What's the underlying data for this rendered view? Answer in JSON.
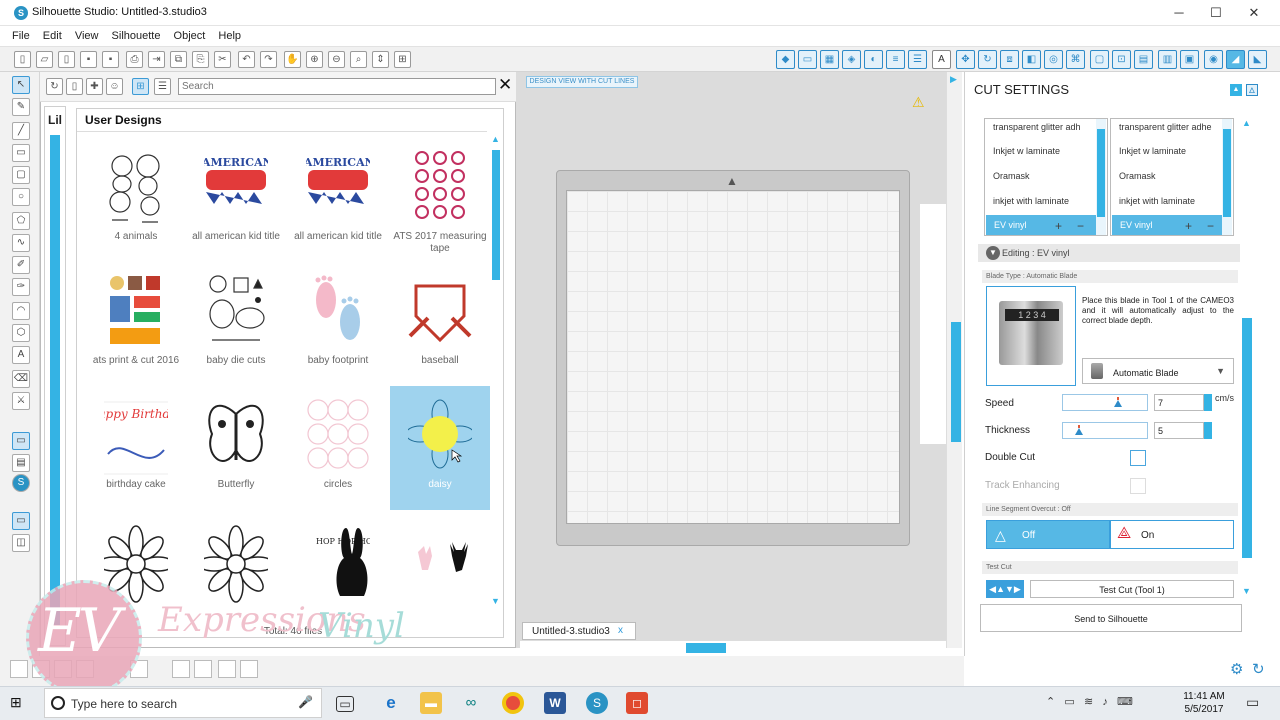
{
  "window": {
    "title": "Silhouette Studio: Untitled-3.studio3",
    "minimize": "─",
    "maximize": "☐",
    "close": "✕"
  },
  "menu": [
    "File",
    "Edit",
    "View",
    "Silhouette",
    "Object",
    "Help"
  ],
  "library": {
    "search_placeholder": "Search",
    "tab_label": "Lil",
    "close_label": "✕",
    "section_title": "User Designs",
    "total": "Total: 46 files",
    "designs": [
      {
        "label": "4 animals"
      },
      {
        "label": "all american kid title"
      },
      {
        "label": "all american kid title"
      },
      {
        "label": "ATS 2017 measuring tape"
      },
      {
        "label": "ats print & cut 2016"
      },
      {
        "label": "baby die cuts"
      },
      {
        "label": "baby footprint"
      },
      {
        "label": "baseball"
      },
      {
        "label": "birthday cake"
      },
      {
        "label": "Butterfly"
      },
      {
        "label": "circles"
      },
      {
        "label": "daisy"
      }
    ],
    "thumb_text": {
      "all_american": "ALL AMERICAN Kid",
      "happy_birthday": "Happy Birthday",
      "hop": "HOP HOP HOP"
    }
  },
  "canvas": {
    "design_view_label": "DESIGN VIEW WITH CUT LINES",
    "doc_tab": "Untitled-3.studio3",
    "doc_tab_close": "x"
  },
  "cut_settings": {
    "title": "CUT SETTINGS",
    "list_left": [
      "transparent glitter adh",
      "Inkjet w laminate",
      "Oramask",
      "inkjet with laminate"
    ],
    "list_right": [
      "transparent glitter adhe",
      "Inkjet w laminate",
      "Oramask",
      "inkjet with laminate"
    ],
    "selected_material": "EV vinyl",
    "editing_label": "Editing : EV vinyl",
    "blade_type_label": "Blade Type : Automatic Blade",
    "blade_numbers": "1 2 3 4",
    "blade_instructions": "Place this blade in Tool 1 of the CAMEO3 and it will automatically adjust to the correct blade depth.",
    "blade_select": "Automatic Blade",
    "speed_label": "Speed",
    "speed_value": "7",
    "speed_level": 0.66,
    "speed_unit": "cm/s",
    "thickness_label": "Thickness",
    "thickness_value": "5",
    "thickness_level": 0.15,
    "double_cut_label": "Double Cut",
    "track_enhancing_label": "Track Enhancing",
    "line_segment_label": "Line Segment Overcut : Off",
    "off_label": "Off",
    "on_label": "On",
    "test_cut_section": "Test Cut",
    "test_cut_button": "Test Cut (Tool 1)",
    "send_button": "Send to Silhouette"
  },
  "watermark": {
    "monogram": "EV",
    "word1": "Expressions",
    "word2": "Vinyl"
  },
  "taskbar": {
    "search_placeholder": "Type here to search",
    "time": "11:41 AM",
    "date": "5/5/2017"
  },
  "colors": {
    "accent": "#34b3e4",
    "selected_tile": "#9fd3ee",
    "canvas_bg": "#dcdcdc"
  }
}
